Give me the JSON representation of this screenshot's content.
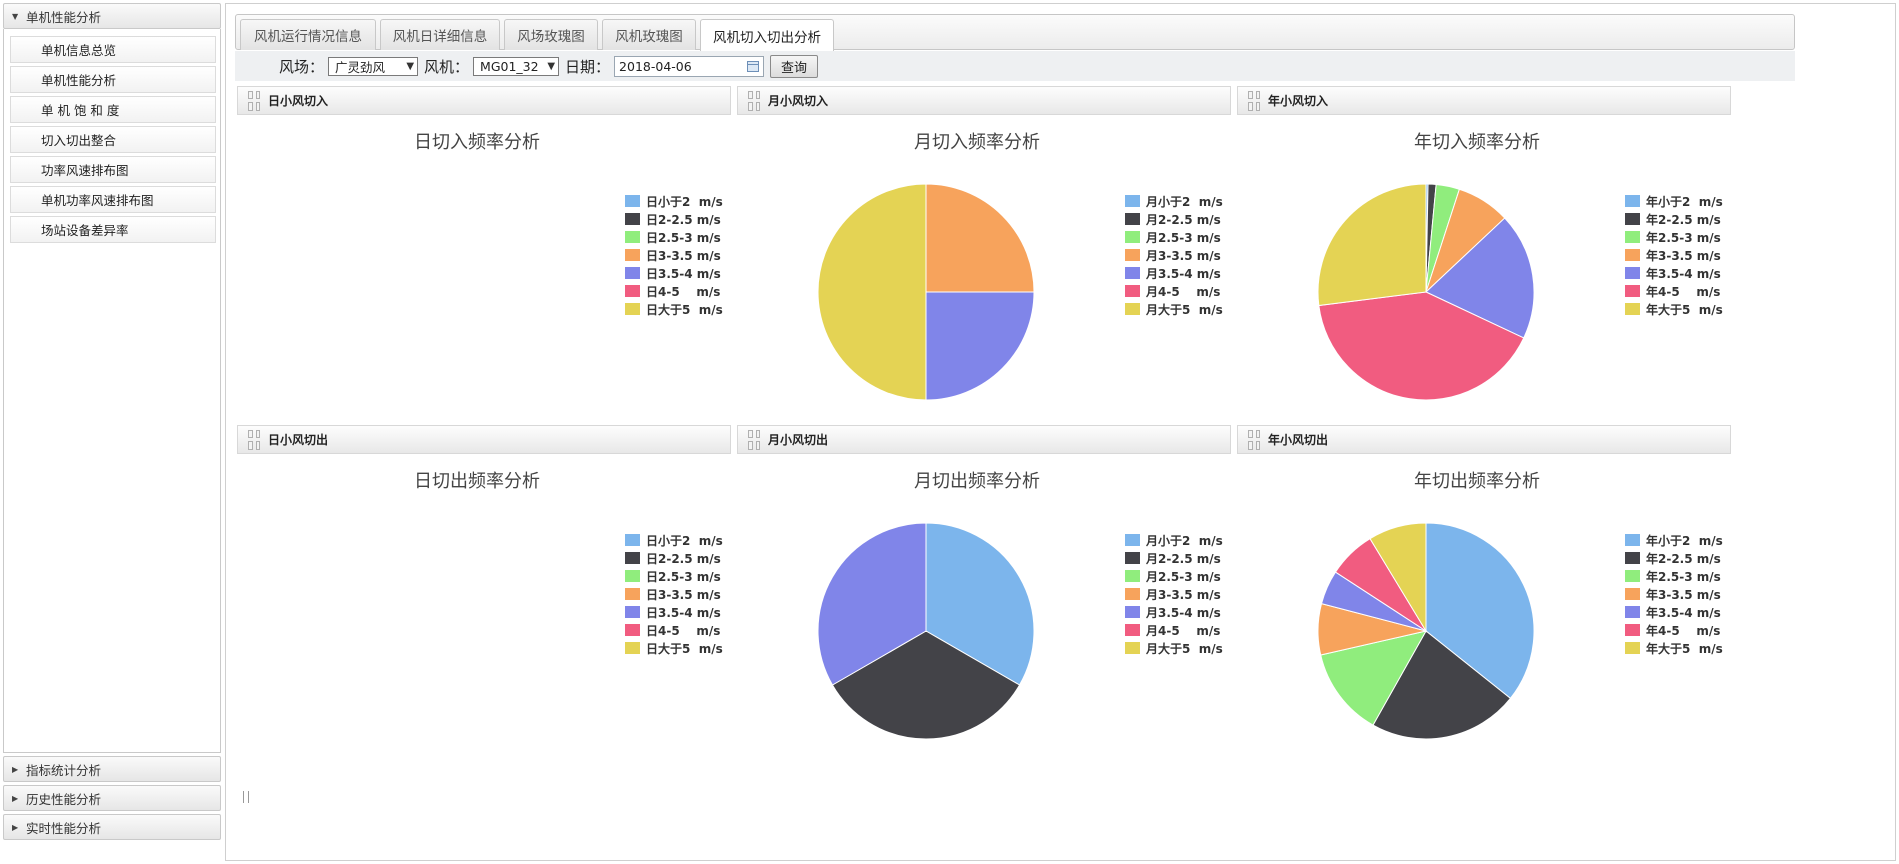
{
  "sidebar": {
    "section_open": "单机性能分析",
    "items": [
      "单机信息总览",
      "单机性能分析",
      "单 机 饱 和 度",
      "切入切出整合",
      "功率风速排布图",
      "单机功率风速排布图",
      "场站设备差异率"
    ],
    "sections_closed": [
      "指标统计分析",
      "历史性能分析",
      "实时性能分析"
    ]
  },
  "tabs": [
    {
      "label": "风机运行情况信息",
      "active": false
    },
    {
      "label": "风机日详细信息",
      "active": false
    },
    {
      "label": "风场玫瑰图",
      "active": false
    },
    {
      "label": "风机玫瑰图",
      "active": false
    },
    {
      "label": "风机切入切出分析",
      "active": true
    }
  ],
  "toolbar": {
    "farm_label": "风场：",
    "farm_value": "广灵劲风",
    "turbine_label": "风机：",
    "turbine_value": "MG01_32",
    "date_label": "日期：",
    "date_value": "2018-04-06",
    "query_label": "查询"
  },
  "colors": [
    "#7cb5ec",
    "#434348",
    "#90ed7d",
    "#f7a35c",
    "#8085e9",
    "#f15c80",
    "#e4d354"
  ],
  "panels": [
    {
      "header": "日小风切入",
      "title": "日切入频率分析",
      "legend": [
        "日小于2  m/s",
        "日2-2.5 m/s",
        "日2.5-3 m/s",
        "日3-3.5 m/s",
        "日3.5-4 m/s",
        "日4-5    m/s",
        "日大于5  m/s"
      ]
    },
    {
      "header": "月小风切入",
      "title": "月切入频率分析",
      "legend": [
        "月小于2  m/s",
        "月2-2.5 m/s",
        "月2.5-3 m/s",
        "月3-3.5 m/s",
        "月3.5-4 m/s",
        "月4-5    m/s",
        "月大于5  m/s"
      ]
    },
    {
      "header": "年小风切入",
      "title": "年切入频率分析",
      "legend": [
        "年小于2  m/s",
        "年2-2.5 m/s",
        "年2.5-3 m/s",
        "年3-3.5 m/s",
        "年3.5-4 m/s",
        "年4-5    m/s",
        "年大于5  m/s"
      ]
    },
    {
      "header": "日小风切出",
      "title": "日切出频率分析",
      "legend": [
        "日小于2  m/s",
        "日2-2.5 m/s",
        "日2.5-3 m/s",
        "日3-3.5 m/s",
        "日3.5-4 m/s",
        "日4-5    m/s",
        "日大于5  m/s"
      ]
    },
    {
      "header": "月小风切出",
      "title": "月切出频率分析",
      "legend": [
        "月小于2  m/s",
        "月2-2.5 m/s",
        "月2.5-3 m/s",
        "月3-3.5 m/s",
        "月3.5-4 m/s",
        "月4-5    m/s",
        "月大于5  m/s"
      ]
    },
    {
      "header": "年小风切出",
      "title": "年切出频率分析",
      "legend": [
        "年小于2  m/s",
        "年2-2.5 m/s",
        "年2.5-3 m/s",
        "年3-3.5 m/s",
        "年3.5-4 m/s",
        "年4-5    m/s",
        "年大于5  m/s"
      ]
    }
  ],
  "chart_data": [
    {
      "type": "pie",
      "title": "日切入频率分析",
      "categories": [
        "日小于2  m/s",
        "日2-2.5 m/s",
        "日2.5-3 m/s",
        "日3-3.5 m/s",
        "日3.5-4 m/s",
        "日4-5    m/s",
        "日大于5  m/s"
      ],
      "values": [
        0,
        0,
        0,
        0,
        0,
        0,
        0
      ],
      "legend": "right"
    },
    {
      "type": "pie",
      "title": "月切入频率分析",
      "categories": [
        "月小于2  m/s",
        "月2-2.5 m/s",
        "月2.5-3 m/s",
        "月3-3.5 m/s",
        "月3.5-4 m/s",
        "月4-5    m/s",
        "月大于5  m/s"
      ],
      "values": [
        0,
        0,
        0,
        1,
        1,
        0,
        2
      ],
      "legend": "right"
    },
    {
      "type": "pie",
      "title": "年切入频率分析",
      "categories": [
        "年小于2  m/s",
        "年2-2.5 m/s",
        "年2.5-3 m/s",
        "年3-3.5 m/s",
        "年3.5-4 m/s",
        "年4-5    m/s",
        "年大于5  m/s"
      ],
      "values": [
        0.3,
        1.2,
        3.5,
        8,
        19,
        41,
        27
      ],
      "legend": "right"
    },
    {
      "type": "pie",
      "title": "日切出频率分析",
      "categories": [
        "日小于2  m/s",
        "日2-2.5 m/s",
        "日2.5-3 m/s",
        "日3-3.5 m/s",
        "日3.5-4 m/s",
        "日4-5    m/s",
        "日大于5  m/s"
      ],
      "values": [
        0,
        0,
        0,
        0,
        0,
        0,
        0
      ],
      "legend": "right"
    },
    {
      "type": "pie",
      "title": "月切出频率分析",
      "categories": [
        "月小于2  m/s",
        "月2-2.5 m/s",
        "月2.5-3 m/s",
        "月3-3.5 m/s",
        "月3.5-4 m/s",
        "月4-5    m/s",
        "月大于5  m/s"
      ],
      "values": [
        1,
        1,
        0,
        0,
        1,
        0,
        0
      ],
      "legend": "right"
    },
    {
      "type": "pie",
      "title": "年切出频率分析",
      "categories": [
        "年小于2  m/s",
        "年2-2.5 m/s",
        "年2.5-3 m/s",
        "年3-3.5 m/s",
        "年3.5-4 m/s",
        "年4-5    m/s",
        "年大于5  m/s"
      ],
      "values": [
        35,
        22,
        13,
        7.5,
        5,
        7,
        8.5
      ],
      "legend": "right"
    }
  ]
}
